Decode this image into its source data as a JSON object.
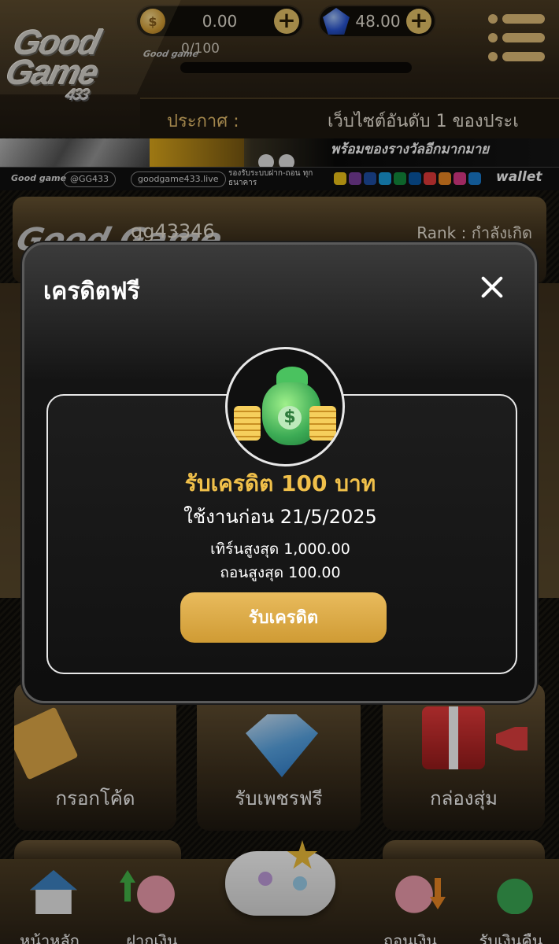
{
  "header": {
    "logo_text": "Good Game",
    "logo_number": "433",
    "balance": "0.00",
    "diamonds": "48.00",
    "mini_logo": "Good game",
    "progress_text": "0/100",
    "progress_fraction": 0.0,
    "announce_label": "ประกาศ :",
    "announce_text": "เว็บไซต์อันดับ 1 ของประเ"
  },
  "banner": {
    "tagline": "พร้อมของรางวัลอีกมากมาย",
    "line_handle": "@GG433",
    "website": "goodgame433.live",
    "deposit_note": "รองรับระบบฝาก-ถอน ทุกธนาคาร",
    "wallet_label": "wallet"
  },
  "user": {
    "username": "gg43346",
    "rank": "Rank : กำลังเกิด"
  },
  "tiles": {
    "code": "กรอกโค้ด",
    "free_diamond": "รับเพชรฟรี",
    "random_box": "กล่องสุ่ม"
  },
  "modal": {
    "title": "เครดิตฟรี",
    "credit_title": "รับเครดิต 100 บาท",
    "expiry": "ใช้งานก่อน 21/5/2025",
    "max_turnover": "เทิร์นสูงสุด 1,000.00",
    "max_withdraw": "ถอนสูงสุด 100.00",
    "claim_label": "รับเครดิต"
  },
  "nav": {
    "home": "หน้าหลัก",
    "deposit": "ฝากเงิน",
    "withdraw": "ถอนเงิน",
    "cashback": "รับเงินคืน"
  },
  "icons": {
    "coin": "coin-icon",
    "diamond": "diamond-icon",
    "menu": "menu-icon",
    "close": "close-icon",
    "money_bag": "money-bag-icon"
  },
  "colors": {
    "gold": "#e4c07a",
    "title_gold": "#f0c04a",
    "button_gold": "#d8a845"
  }
}
